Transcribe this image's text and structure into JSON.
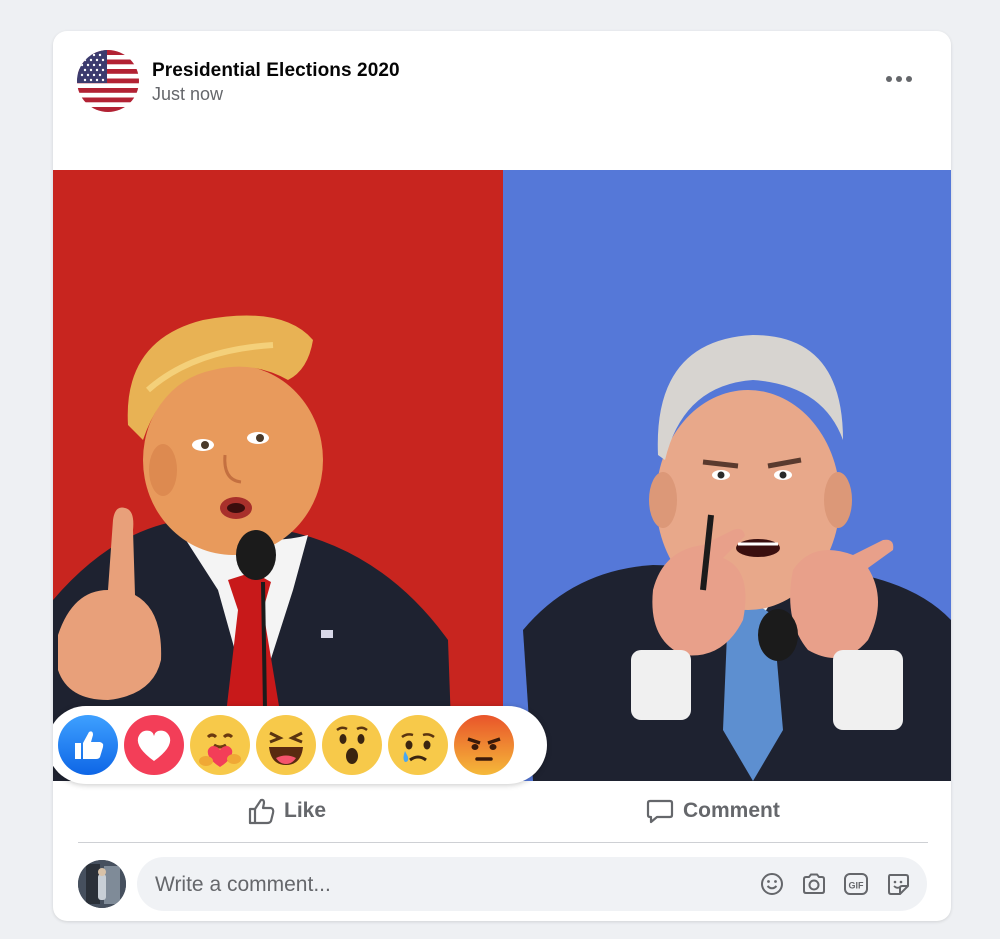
{
  "post": {
    "page_name": "Presidential Elections 2020",
    "timestamp": "Just now",
    "image_description_colors": {
      "left_bg": "#c8251f",
      "right_bg": "#5578d8"
    }
  },
  "reactions": [
    {
      "name": "like",
      "icon": "like-reaction-icon"
    },
    {
      "name": "love",
      "icon": "love-reaction-icon"
    },
    {
      "name": "care",
      "icon": "care-reaction-icon"
    },
    {
      "name": "haha",
      "icon": "haha-reaction-icon"
    },
    {
      "name": "wow",
      "icon": "wow-reaction-icon"
    },
    {
      "name": "sad",
      "icon": "sad-reaction-icon"
    },
    {
      "name": "angry",
      "icon": "angry-reaction-icon"
    }
  ],
  "actions": {
    "like_label": "Like",
    "comment_label": "Comment"
  },
  "comment": {
    "placeholder": "Write a comment...",
    "icons": [
      "emoji-icon",
      "camera-icon",
      "gif-icon",
      "sticker-icon"
    ]
  },
  "colors": {
    "text_secondary": "#65676b",
    "background": "#eef0f3",
    "card": "#ffffff",
    "like_blue": "#1877f2",
    "love_red": "#f33e58"
  }
}
